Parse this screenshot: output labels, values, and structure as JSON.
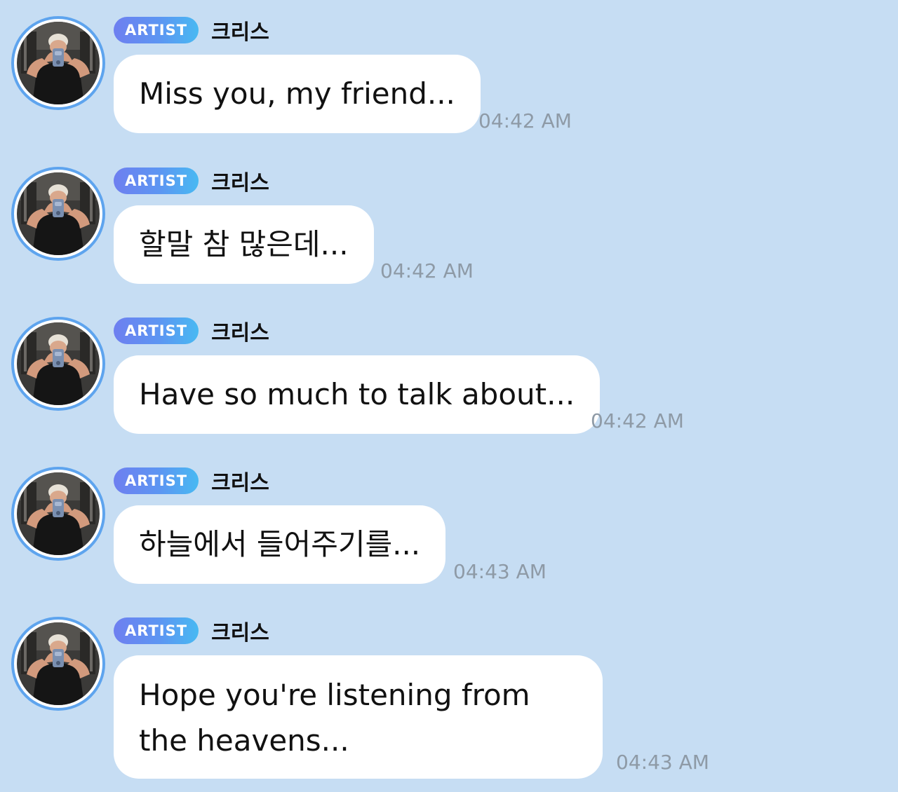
{
  "messages": [
    {
      "badge": "ARTIST",
      "sender": "크리스",
      "text": "Miss you, my friend...",
      "time": "04:42 AM"
    },
    {
      "badge": "ARTIST",
      "sender": "크리스",
      "text": "할말 참 많은데...",
      "time": "04:42 AM"
    },
    {
      "badge": "ARTIST",
      "sender": "크리스",
      "text": "Have so much to talk about...",
      "time": "04:42 AM"
    },
    {
      "badge": "ARTIST",
      "sender": "크리스",
      "text": "하늘에서 들어주기를...",
      "time": "04:43 AM"
    },
    {
      "badge": "ARTIST",
      "sender": "크리스",
      "text": "Hope you're listening from the heavens...",
      "time": "04:43 AM"
    }
  ],
  "colors": {
    "background": "#c6ddf3",
    "bubble": "#ffffff",
    "avatar_ring": "#5ea4ee",
    "badge_gradient_start": "#6e7ff0",
    "badge_gradient_end": "#48b9f2",
    "timestamp": "#8e9aa6"
  },
  "icons": {
    "avatar": "profile-photo-avatar"
  }
}
